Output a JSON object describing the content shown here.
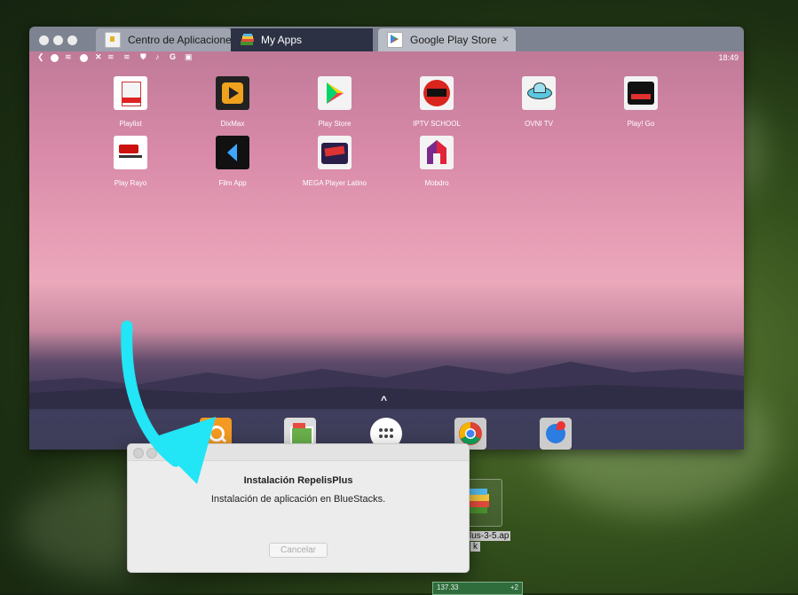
{
  "tabs": [
    {
      "label": "Centro de Aplicaciones",
      "icon": "app-center-icon"
    },
    {
      "label": "My Apps",
      "icon": "bluestacks-icon"
    },
    {
      "label": "Google Play Store",
      "icon": "play-store-icon"
    }
  ],
  "tab_close": "×",
  "status": {
    "time": "18:49"
  },
  "apps": [
    {
      "label": "Playlist",
      "color": "#ffffff"
    },
    {
      "label": "DixMax",
      "color": "#1d1d1d"
    },
    {
      "label": "Play Store",
      "color": "#f4f4f4"
    },
    {
      "label": "IPTV SCHOOL",
      "color": "#f4f4f4"
    },
    {
      "label": "OVNI TV",
      "color": "#f4f4f4"
    },
    {
      "label": "Play! Go",
      "color": "#f4f4f4"
    },
    {
      "label": "Play Rayo",
      "color": "#ffffff"
    },
    {
      "label": "Film App",
      "color": "#111111"
    },
    {
      "label": "MEGA Player Latino",
      "color": "#f4f4f4"
    },
    {
      "label": "Mobdro",
      "color": "#f4f4f4"
    }
  ],
  "launcher_arrow": "^",
  "nav": {
    "back": "◁",
    "home": "○",
    "recents": "□"
  },
  "dialog": {
    "title": "Instalación RepelisPlus",
    "message": "Instalación de aplicación en BlueStacks.",
    "cancel": "Cancelar"
  },
  "desktop_file": {
    "name_line1": "lus-3-5.ap",
    "name_line2": "k"
  },
  "taskbar": {
    "left": "137.33",
    "right": "+2"
  },
  "colors": {
    "arrow": "#22e5f5",
    "accent": "#2c3144"
  }
}
